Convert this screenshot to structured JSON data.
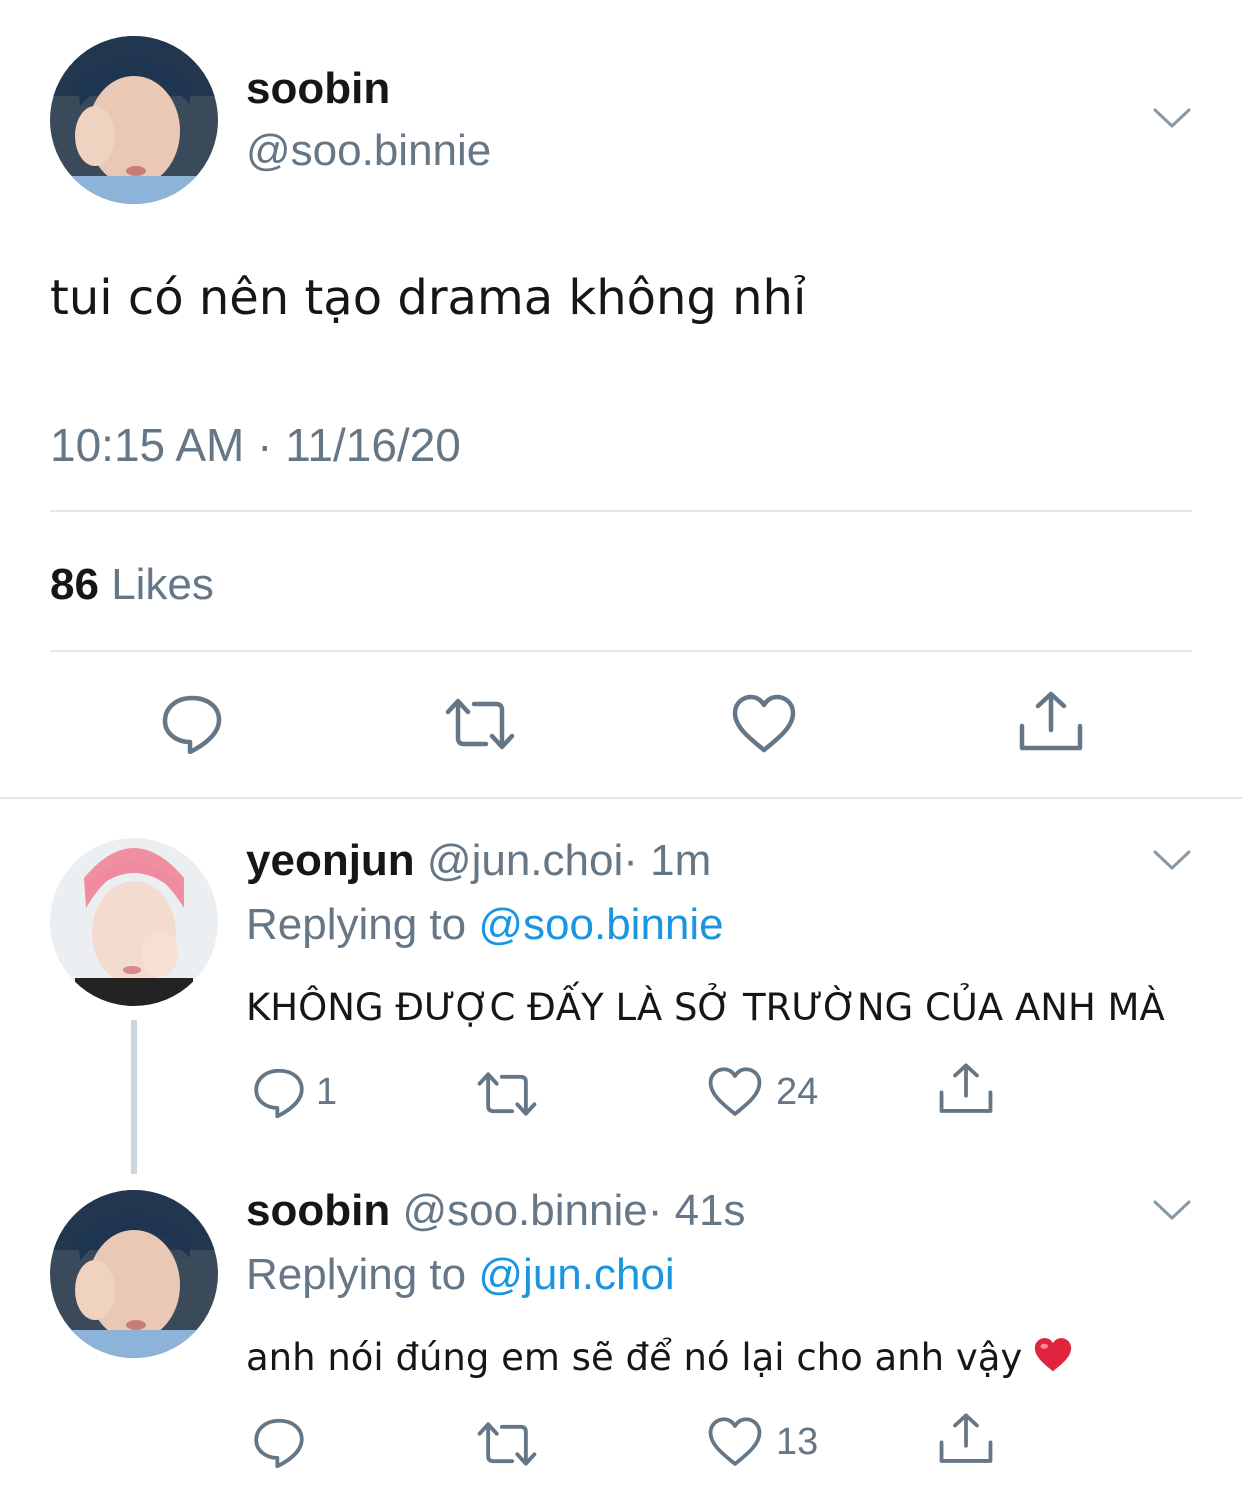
{
  "main_tweet": {
    "display_name": "soobin",
    "handle": "@soo.binnie",
    "text": "tui có nên tạo drama không nhỉ",
    "timestamp": "10:15 AM · 11/16/20",
    "likes_count": "86",
    "likes_label": "Likes",
    "icons": [
      "reply-icon",
      "retweet-icon",
      "like-icon",
      "share-icon",
      "chevron-down-icon"
    ]
  },
  "replies": [
    {
      "display_name": "yeonjun",
      "handle": "@jun.choi",
      "time": "· 1m",
      "replying_label": "Replying to",
      "replying_to": "@soo.binnie",
      "text": "KHÔNG ĐƯỢC ĐẤY LÀ SỞ TRƯỜNG CỦA ANH MÀ",
      "reply_count": "1",
      "like_count": "24"
    },
    {
      "display_name": "soobin",
      "handle": "@soo.binnie",
      "time": "· 41s",
      "replying_label": "Replying to",
      "replying_to": "@jun.choi",
      "text": "anh nói đúng em sẽ để nó lại cho anh vậy",
      "emoji": "heart-emoji",
      "reply_count": "",
      "like_count": "13"
    }
  ],
  "colors": {
    "text": "#14171a",
    "secondary": "#657786",
    "link": "#1b95e0",
    "divider": "#e1e8ed",
    "heart_emoji": "#e0243d"
  }
}
